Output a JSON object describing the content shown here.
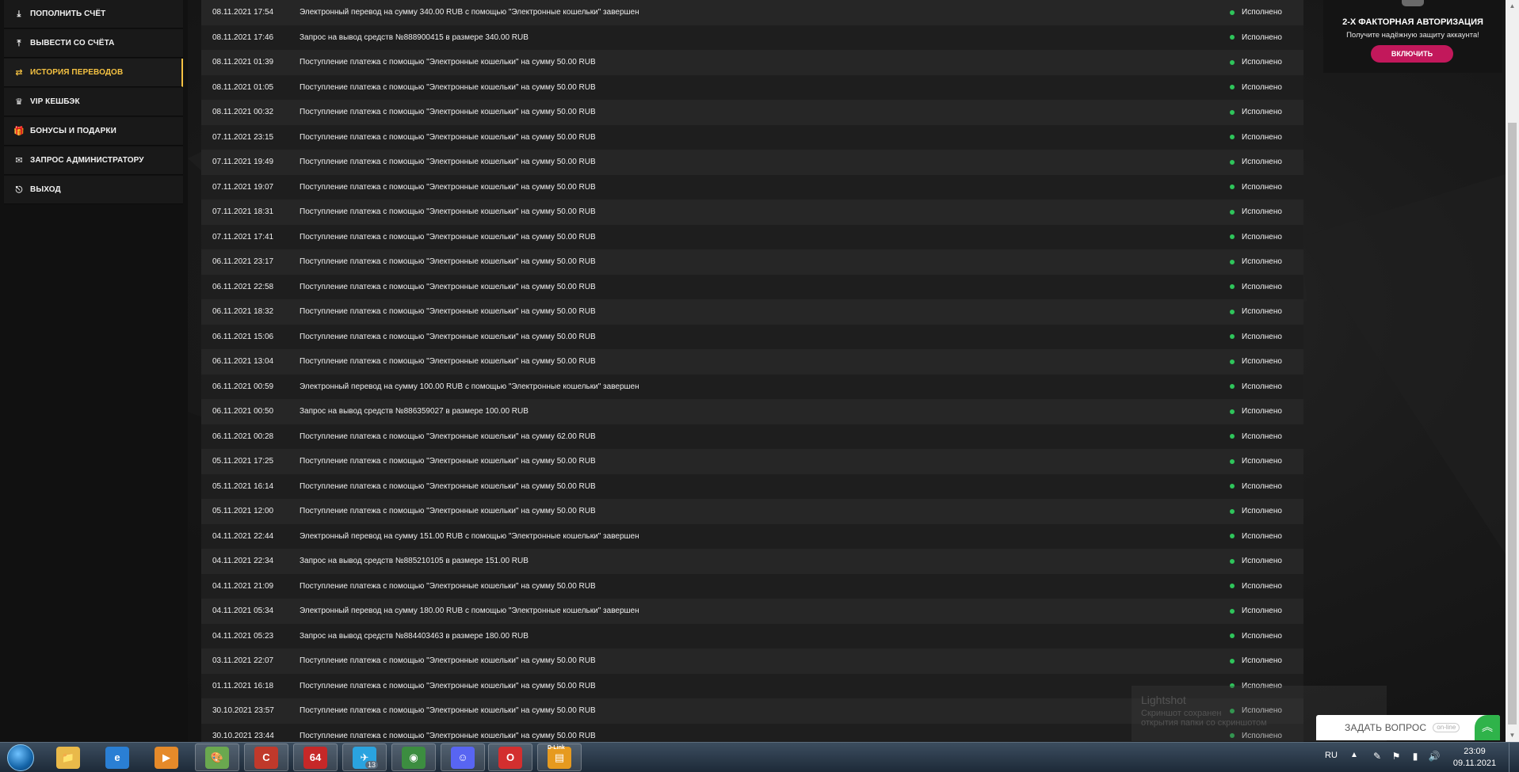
{
  "sidebar": {
    "items": [
      {
        "label": "ПОПОЛНИТЬ СЧЁТ",
        "icon": "⤓",
        "name": "deposit"
      },
      {
        "label": "ВЫВЕСТИ СО СЧЁТА",
        "icon": "⤒",
        "name": "withdraw"
      },
      {
        "label": "ИСТОРИЯ ПЕРЕВОДОВ",
        "icon": "⇄",
        "name": "history"
      },
      {
        "label": "VIP КЕШБЭК",
        "icon": "♛",
        "name": "vip-cashback"
      },
      {
        "label": "БОНУСЫ И ПОДАРКИ",
        "icon": "🎁",
        "name": "bonuses"
      },
      {
        "label": "ЗАПРОС АДМИНИСТРАТОРУ",
        "icon": "✉",
        "name": "admin-request"
      },
      {
        "label": "ВЫХОД",
        "icon": "⎋",
        "name": "logout"
      }
    ]
  },
  "transactions": [
    {
      "date": "08.11.2021 17:54",
      "desc": "Электронный перевод на сумму 340.00 RUB с помощью \"Электронные кошельки\" завершен",
      "status": "Исполнено"
    },
    {
      "date": "08.11.2021 17:46",
      "desc": "Запрос на вывод средств №888900415 в размере 340.00 RUB",
      "status": "Исполнено"
    },
    {
      "date": "08.11.2021 01:39",
      "desc": "Поступление платежа с помощью \"Электронные кошельки\" на сумму 50.00 RUB",
      "status": "Исполнено"
    },
    {
      "date": "08.11.2021 01:05",
      "desc": "Поступление платежа с помощью \"Электронные кошельки\" на сумму 50.00 RUB",
      "status": "Исполнено"
    },
    {
      "date": "08.11.2021 00:32",
      "desc": "Поступление платежа с помощью \"Электронные кошельки\" на сумму 50.00 RUB",
      "status": "Исполнено"
    },
    {
      "date": "07.11.2021 23:15",
      "desc": "Поступление платежа с помощью \"Электронные кошельки\" на сумму 50.00 RUB",
      "status": "Исполнено"
    },
    {
      "date": "07.11.2021 19:49",
      "desc": "Поступление платежа с помощью \"Электронные кошельки\" на сумму 50.00 RUB",
      "status": "Исполнено"
    },
    {
      "date": "07.11.2021 19:07",
      "desc": "Поступление платежа с помощью \"Электронные кошельки\" на сумму 50.00 RUB",
      "status": "Исполнено"
    },
    {
      "date": "07.11.2021 18:31",
      "desc": "Поступление платежа с помощью \"Электронные кошельки\" на сумму 50.00 RUB",
      "status": "Исполнено"
    },
    {
      "date": "07.11.2021 17:41",
      "desc": "Поступление платежа с помощью \"Электронные кошельки\" на сумму 50.00 RUB",
      "status": "Исполнено"
    },
    {
      "date": "06.11.2021 23:17",
      "desc": "Поступление платежа с помощью \"Электронные кошельки\" на сумму 50.00 RUB",
      "status": "Исполнено"
    },
    {
      "date": "06.11.2021 22:58",
      "desc": "Поступление платежа с помощью \"Электронные кошельки\" на сумму 50.00 RUB",
      "status": "Исполнено"
    },
    {
      "date": "06.11.2021 18:32",
      "desc": "Поступление платежа с помощью \"Электронные кошельки\" на сумму 50.00 RUB",
      "status": "Исполнено"
    },
    {
      "date": "06.11.2021 15:06",
      "desc": "Поступление платежа с помощью \"Электронные кошельки\" на сумму 50.00 RUB",
      "status": "Исполнено"
    },
    {
      "date": "06.11.2021 13:04",
      "desc": "Поступление платежа с помощью \"Электронные кошельки\" на сумму 50.00 RUB",
      "status": "Исполнено"
    },
    {
      "date": "06.11.2021 00:59",
      "desc": "Электронный перевод на сумму 100.00 RUB с помощью \"Электронные кошельки\" завершен",
      "status": "Исполнено"
    },
    {
      "date": "06.11.2021 00:50",
      "desc": "Запрос на вывод средств №886359027 в размере 100.00 RUB",
      "status": "Исполнено"
    },
    {
      "date": "06.11.2021 00:28",
      "desc": "Поступление платежа с помощью \"Электронные кошельки\" на сумму 62.00 RUB",
      "status": "Исполнено"
    },
    {
      "date": "05.11.2021 17:25",
      "desc": "Поступление платежа с помощью \"Электронные кошельки\" на сумму 50.00 RUB",
      "status": "Исполнено"
    },
    {
      "date": "05.11.2021 16:14",
      "desc": "Поступление платежа с помощью \"Электронные кошельки\" на сумму 50.00 RUB",
      "status": "Исполнено"
    },
    {
      "date": "05.11.2021 12:00",
      "desc": "Поступление платежа с помощью \"Электронные кошельки\" на сумму 50.00 RUB",
      "status": "Исполнено"
    },
    {
      "date": "04.11.2021 22:44",
      "desc": "Электронный перевод на сумму 151.00 RUB с помощью \"Электронные кошельки\" завершен",
      "status": "Исполнено"
    },
    {
      "date": "04.11.2021 22:34",
      "desc": "Запрос на вывод средств №885210105 в размере 151.00 RUB",
      "status": "Исполнено"
    },
    {
      "date": "04.11.2021 21:09",
      "desc": "Поступление платежа с помощью \"Электронные кошельки\" на сумму 50.00 RUB",
      "status": "Исполнено"
    },
    {
      "date": "04.11.2021 05:34",
      "desc": "Электронный перевод на сумму 180.00 RUB с помощью \"Электронные кошельки\" завершен",
      "status": "Исполнено"
    },
    {
      "date": "04.11.2021 05:23",
      "desc": "Запрос на вывод средств №884403463 в размере 180.00 RUB",
      "status": "Исполнено"
    },
    {
      "date": "03.11.2021 22:07",
      "desc": "Поступление платежа с помощью \"Электронные кошельки\" на сумму 50.00 RUB",
      "status": "Исполнено"
    },
    {
      "date": "01.11.2021 16:18",
      "desc": "Поступление платежа с помощью \"Электронные кошельки\" на сумму 50.00 RUB",
      "status": "Исполнено"
    },
    {
      "date": "30.10.2021 23:57",
      "desc": "Поступление платежа с помощью \"Электронные кошельки\" на сумму 50.00 RUB",
      "status": "Исполнено"
    },
    {
      "date": "30.10.2021 23:44",
      "desc": "Поступление платежа с помощью \"Электронные кошельки\" на сумму 50.00 RUB",
      "status": "Исполнено"
    }
  ],
  "twofa": {
    "title": "2-Х ФАКТОРНАЯ АВТОРИЗАЦИЯ",
    "description": "Получите надёжную защиту аккаунта!",
    "button": "ВКЛЮЧИТЬ"
  },
  "lightshot": {
    "title": "Lightshot",
    "line1": "Скриншот сохранен",
    "line2": "открытия папки со скриншотом"
  },
  "ask": {
    "label": "ЗАДАТЬ ВОПРОС",
    "status": "on-line",
    "expand_icon": "︽"
  },
  "taskbar": {
    "apps": [
      {
        "name": "file-explorer",
        "glyph": "📁",
        "color": "#e9b94a"
      },
      {
        "name": "internet-explorer",
        "glyph": "e",
        "color": "#2a7fd4"
      },
      {
        "name": "media-player",
        "glyph": "▶",
        "color": "#e58a2a"
      },
      {
        "name": "paint",
        "glyph": "🎨",
        "color": "#6aa84f"
      },
      {
        "name": "ccleaner",
        "glyph": "C",
        "color": "#c0392b"
      },
      {
        "name": "aida64",
        "glyph": "64",
        "color": "#c62828"
      },
      {
        "name": "telegram",
        "glyph": "✈",
        "color": "#2aa3df"
      },
      {
        "name": "chrome",
        "glyph": "◉",
        "color": "#3c8d40"
      },
      {
        "name": "discord",
        "glyph": "☺",
        "color": "#5865f2"
      },
      {
        "name": "opera",
        "glyph": "O",
        "color": "#d32f2f"
      },
      {
        "name": "dlink",
        "glyph": "▤",
        "color": "#e69a1f"
      }
    ],
    "telegram_badge": "13",
    "dlink_label": "D-Link",
    "language": "RU",
    "time": "23:09",
    "date": "09.11.2021"
  },
  "colors": {
    "accent_gold": "#f5c242",
    "status_green": "#2fc55b",
    "twofa_button": "#c2185b",
    "ask_green": "#2fb34a"
  }
}
